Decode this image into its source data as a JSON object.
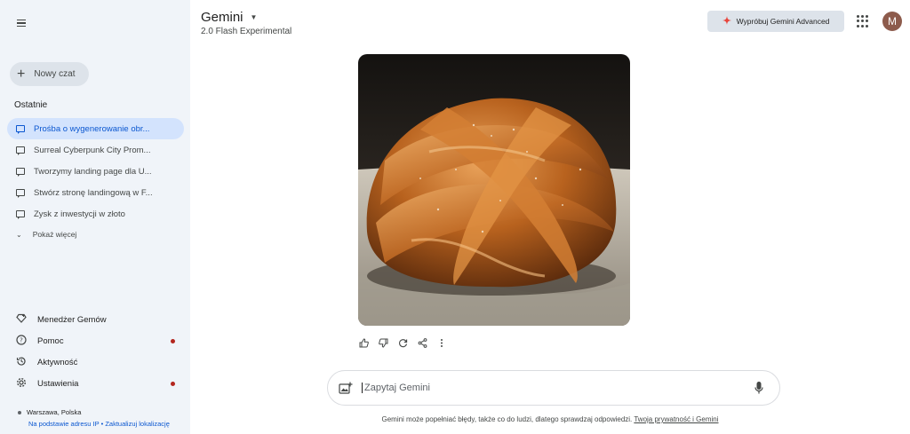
{
  "sidebar": {
    "new_chat_label": "Nowy czat",
    "recent_title": "Ostatnie",
    "recent_items": [
      {
        "label": "Prośba o wygenerowanie obr..."
      },
      {
        "label": "Surreal Cyberpunk City Prom..."
      },
      {
        "label": "Tworzymy landing page dla U..."
      },
      {
        "label": "Stwórz stronę landingową w F..."
      },
      {
        "label": "Zysk z inwestycji w złoto"
      }
    ],
    "show_more_label": "Pokaż więcej",
    "nav": {
      "gems": "Menedżer Gemów",
      "help": "Pomoc",
      "activity": "Aktywność",
      "settings": "Ustawienia"
    },
    "location": {
      "place": "Warszawa, Polska",
      "source": "Na podstawie adresu IP",
      "separator": "•",
      "update": "Zaktualizuj lokalizację"
    }
  },
  "header": {
    "title": "Gemini",
    "model": "2.0 Flash Experimental",
    "advanced_button": "Wypróbuj Gemini Advanced",
    "avatar_initial": "M"
  },
  "prompt": {
    "placeholder": "Zapytaj Gemini"
  },
  "footer": {
    "disclaimer": "Gemini może popełniać błędy, także co do ludzi, dlatego sprawdzaj odpowiedzi.",
    "privacy_link": "Twoja prywatność i Gemini"
  },
  "colors": {
    "sidebar_bg": "#f0f4f9",
    "active_item_bg": "#d3e3fd",
    "active_item_text": "#0b57d0",
    "notification_dot": "#b3261e",
    "avatar_bg": "#8d5b4c"
  },
  "icons": [
    "menu-icon",
    "plus-icon",
    "chat-icon",
    "chevron-down-icon",
    "gem-icon",
    "help-icon",
    "history-icon",
    "gear-icon",
    "spark-icon",
    "apps-icon",
    "thumb-up-icon",
    "thumb-down-icon",
    "regenerate-icon",
    "share-icon",
    "more-icon",
    "add-image-icon",
    "mic-icon"
  ]
}
